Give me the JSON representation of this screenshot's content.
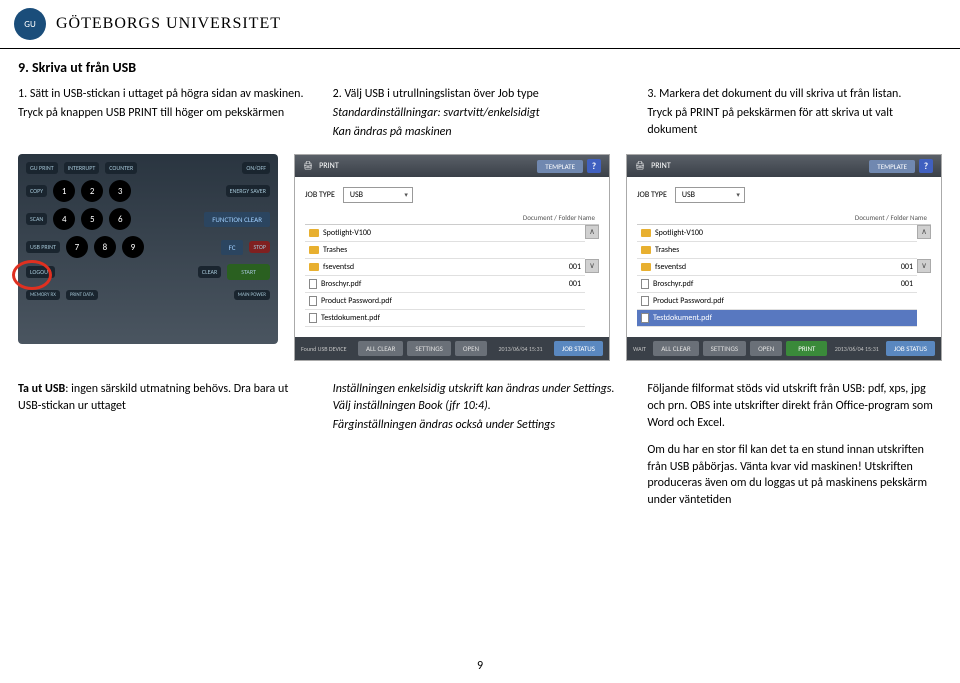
{
  "header": {
    "logo_text": "GU",
    "university": "GÖTEBORGS UNIVERSITET"
  },
  "section_title": "9. Skriva ut från USB",
  "steps_top": {
    "col1_line1": "1. Sätt in USB-stickan i uttaget på högra sidan av maskinen.",
    "col1_line2": "Tryck på knappen USB PRINT  till höger om pekskärmen",
    "col2_line1": "2. Välj  USB i utrullningslistan över Job type",
    "col2_line2": "Standardinställningar: svartvitt/enkelsidigt",
    "col2_line3": "Kan ändras på maskinen",
    "col3_line1": "3. Markera det dokument du vill skriva ut från listan.",
    "col3_line2": "Tryck på PRINT på pekskärmen för att skriva ut valt dokument"
  },
  "printer_panel": {
    "labels": [
      "GU PRINT",
      "INTERRUPT",
      "COUNTER",
      "ON/OFF",
      "COPY",
      "ENERGY SAVER",
      "SCAN",
      "FUNCTION CLEAR",
      "USB PRINT",
      "FC",
      "STOP",
      "LOGOUT",
      "CLEAR",
      "START",
      "MEMORY RX",
      "PRINT DATA",
      "MAIN POWER"
    ]
  },
  "print_screen": {
    "title": "PRINT",
    "template": "TEMPLATE",
    "help": "?",
    "jobtype_label": "JOB TYPE",
    "jobtype_value": "USB",
    "list_header": "Document / Folder Name",
    "rows": [
      {
        "icon": "folder",
        "name": "Spotlight-V100",
        "val": ""
      },
      {
        "icon": "folder",
        "name": "Trashes",
        "val": ""
      },
      {
        "icon": "folder",
        "name": "fseventsd",
        "val": "001"
      },
      {
        "icon": "file",
        "name": "Broschyr.pdf",
        "val": "001"
      },
      {
        "icon": "file",
        "name": "Product Password.pdf",
        "val": ""
      },
      {
        "icon": "file",
        "name": "Testdokument.pdf",
        "val": ""
      }
    ],
    "found": "Found USB DEVICE",
    "b_allclear": "ALL CLEAR",
    "b_settings": "SETTINGS",
    "b_open": "OPEN",
    "b_print": "PRINT",
    "jobstatus": "JOB STATUS",
    "time": "2013/06/04\n15:31",
    "wait": "WAIT"
  },
  "steps_bottom": {
    "col1_line1": "Ta ut USB: ingen särskild utmatning behövs. Dra bara ut USB-stickan ur uttaget",
    "col1_bold_prefix": "Ta ut USB",
    "col2_line1": "Inställningen enkelsidig utskrift kan ändras under Settings. Välj inställningen Book (jfr 10:4).",
    "col2_line2": "Färginställningen ändras också under Settings",
    "col3_line1": "Följande filformat stöds vid utskrift från USB: pdf, xps, jpg och prn. OBS inte utskrifter direkt från Office-program som Word och Excel.",
    "col3_line2": "Om du har en stor fil kan det ta en stund innan utskriften från USB påbörjas. Vänta kvar vid maskinen! Utskriften produceras även om du loggas ut på maskinens pekskärm under väntetiden"
  },
  "page_number": "9"
}
